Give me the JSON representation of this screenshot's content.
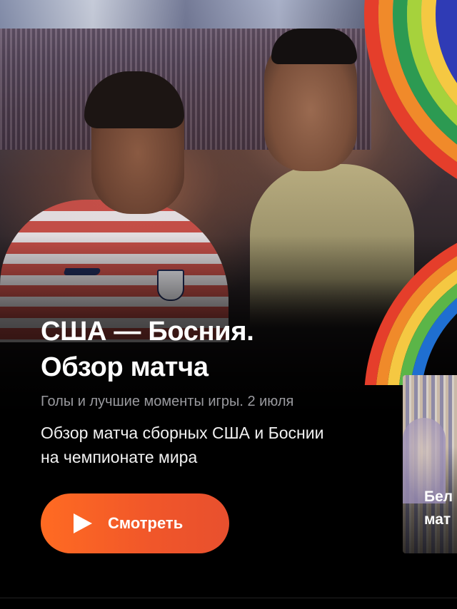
{
  "hero": {
    "title_line1": "США — Босния.",
    "title_line2": "Обзор матча",
    "subtitle": "Голы и лучшие моменты игры. 2 июля",
    "description": "Обзор матча сборных США и Боснии на чемпионате мира",
    "watch_button": {
      "label": "Смотреть",
      "icon": "play-icon"
    }
  },
  "next_card": {
    "title_line1": "Бел",
    "title_line2": "мат"
  },
  "colors": {
    "accent_button": "#f0562a",
    "background": "#000000",
    "subtitle": "#9a9a9f",
    "rainbow": [
      "#e53e2b",
      "#f08a2a",
      "#f5c842",
      "#5bb548",
      "#1f6fd1",
      "#3a3fb0"
    ]
  }
}
